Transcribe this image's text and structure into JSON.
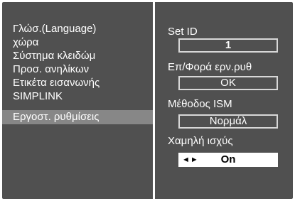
{
  "menu": {
    "items": [
      {
        "label": "Γλώσ.(Language)"
      },
      {
        "label": "χώρα"
      },
      {
        "label": "Σύστημα κλειδώμ"
      },
      {
        "label": "Προσ. ανηλίκων"
      },
      {
        "label": "Ετικέτα εισανωνής"
      },
      {
        "label": "SIMPLINK"
      },
      {
        "label": "Εργοστ. ρυθμίσεις",
        "selected": true
      }
    ]
  },
  "options": {
    "set_id": {
      "label": "Set ID",
      "value": "1"
    },
    "factory_reset": {
      "label": "Επ/Φορά ερν.ρυθ",
      "value": "OK"
    },
    "ism_method": {
      "label": "Μέθοδος ISM",
      "value": "Νορμάλ"
    },
    "low_power": {
      "label": "Χαμηλή ισχύς",
      "value": "On",
      "arrows": "◄►"
    }
  },
  "colors": {
    "panel_bg": "#505050",
    "selected_bg": "#878787",
    "text": "#ffffff",
    "active_box_bg": "#ffffff"
  }
}
